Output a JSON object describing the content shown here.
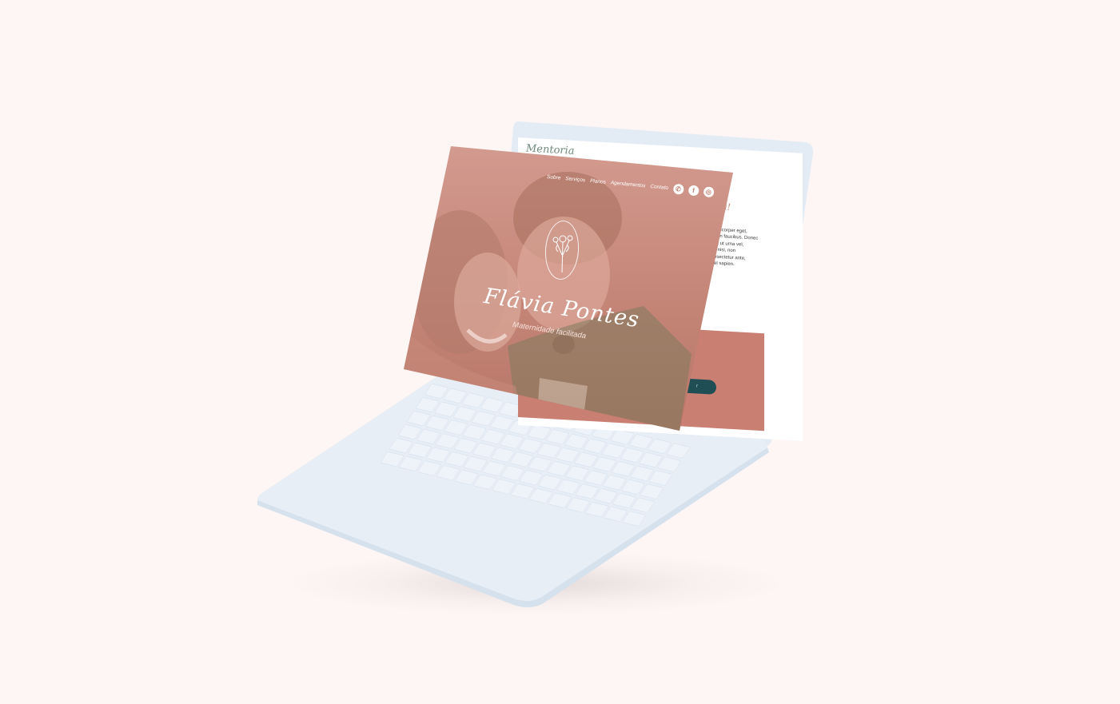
{
  "page": {
    "background_color": "#fdf6f4"
  },
  "laptop": {
    "body_color": "#e6eef6",
    "key_color": "#edf2f8"
  },
  "back_page": {
    "title": "Mentoria",
    "heading_fragment": "a!",
    "body_lines": [
      "lamcorper eget,",
      "is in faucibus. Donec",
      "tis ut urna vel,",
      "s nisi, non",
      "nsectetur ante,",
      "el sapien."
    ],
    "button_label": "r",
    "band_color": "#c97f72",
    "button_color": "#1f4e55"
  },
  "hero": {
    "nav": [
      "Sobre",
      "Serviços",
      "Planos",
      "Agendamentos",
      "Contato"
    ],
    "social_icons": [
      "whatsapp-icon",
      "facebook-icon",
      "instagram-icon"
    ],
    "logo_icon": "flower-bouquet-icon",
    "brand_name": "Flávia Pontes",
    "tagline": "Maternidade facilitada",
    "overlay_color": "#c48577"
  }
}
